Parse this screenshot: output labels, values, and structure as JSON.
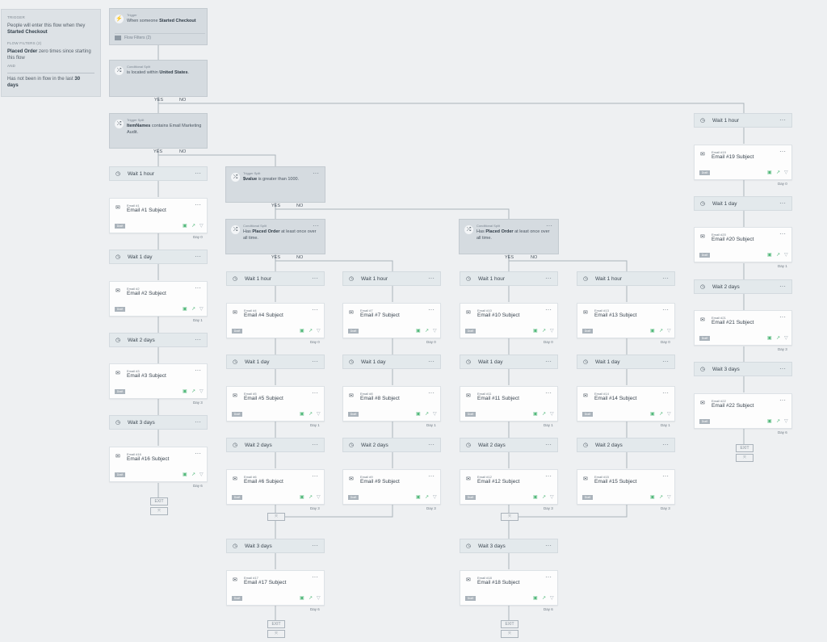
{
  "info": {
    "trigger_label": "Trigger",
    "trigger_line": "People will enter this flow when they",
    "trigger_event": "Started Checkout",
    "filters_label": "Flow Filters (2)",
    "filter1_event": "Placed Order",
    "filter1_rest": "zero times since starting this flow",
    "and_label": "And",
    "filter2_text": "Has not been in flow in the last",
    "filter2_num": "30",
    "filter2_unit": "days"
  },
  "trigger": {
    "label": "Trigger",
    "text": "When someone",
    "event": "Started Checkout",
    "filters_button": "Flow Filters (2)"
  },
  "split1": {
    "label": "Conditional Split",
    "pre": "is located",
    "mid": "within",
    "country": "United States",
    "post": "."
  },
  "split2": {
    "label": "Trigger Split",
    "field": "ItemNames",
    "text": "contains Email Marketing Audit."
  },
  "split3": {
    "label": "Trigger Split",
    "field": "$value",
    "text": "is greater than 1000."
  },
  "split4": {
    "label": "Conditional Split",
    "pre": "Has",
    "event": "Placed Order",
    "post": "at least once over all time."
  },
  "split5": {
    "label": "Conditional Split",
    "pre": "Has",
    "event": "Placed Order",
    "post": "at least once over all time."
  },
  "labels": {
    "yes": "YES",
    "no": "NO",
    "exit": "EXIT",
    "draft": "Draft",
    "menu": "···"
  },
  "waits": [
    {
      "label": "Wait 1 hour"
    },
    {
      "label": "Wait 1 day"
    },
    {
      "label": "Wait 2 days"
    },
    {
      "label": "Wait 3 days"
    },
    {
      "label": "Wait 1 hour"
    },
    {
      "label": "Wait 1 day"
    },
    {
      "label": "Wait 2 days"
    },
    {
      "label": "Wait 3 days"
    },
    {
      "label": "Wait 1 hour"
    },
    {
      "label": "Wait 1 day"
    },
    {
      "label": "Wait 2 days"
    },
    {
      "label": "Wait 1 hour"
    },
    {
      "label": "Wait 1 day"
    },
    {
      "label": "Wait 2 days"
    },
    {
      "label": "Wait 3 days"
    },
    {
      "label": "Wait 1 hour"
    },
    {
      "label": "Wait 1 day"
    },
    {
      "label": "Wait 2 days"
    },
    {
      "label": "Wait 1 hour"
    },
    {
      "label": "Wait 1 day"
    },
    {
      "label": "Wait 2 days"
    },
    {
      "label": "Wait 3 days"
    }
  ],
  "emails": [
    {
      "name": "Email #1",
      "subject": "Email #1 Subject",
      "day": "Day 0"
    },
    {
      "name": "Email #2",
      "subject": "Email #2 Subject",
      "day": "Day 1"
    },
    {
      "name": "Email #3",
      "subject": "Email #3 Subject",
      "day": "Day 3"
    },
    {
      "name": "Email #16",
      "subject": "Email #16 Subject",
      "day": "Day 6"
    },
    {
      "name": "Email #4",
      "subject": "Email #4 Subject",
      "day": "Day 0"
    },
    {
      "name": "Email #5",
      "subject": "Email #5 Subject",
      "day": "Day 1"
    },
    {
      "name": "Email #6",
      "subject": "Email #6 Subject",
      "day": "Day 3"
    },
    {
      "name": "Email #17",
      "subject": "Email #17 Subject",
      "day": "Day 6"
    },
    {
      "name": "Email #7",
      "subject": "Email #7 Subject",
      "day": "Day 0"
    },
    {
      "name": "Email #8",
      "subject": "Email #8 Subject",
      "day": "Day 1"
    },
    {
      "name": "Email #9",
      "subject": "Email #9 Subject",
      "day": "Day 3"
    },
    {
      "name": "Email #10",
      "subject": "Email #10 Subject",
      "day": "Day 0"
    },
    {
      "name": "Email #11",
      "subject": "Email #11 Subject",
      "day": "Day 1"
    },
    {
      "name": "Email #12",
      "subject": "Email #12 Subject",
      "day": "Day 3"
    },
    {
      "name": "Email #18",
      "subject": "Email #18 Subject",
      "day": "Day 6"
    },
    {
      "name": "Email #13",
      "subject": "Email #13 Subject",
      "day": "Day 0"
    },
    {
      "name": "Email #14",
      "subject": "Email #14 Subject",
      "day": "Day 1"
    },
    {
      "name": "Email #15",
      "subject": "Email #15 Subject",
      "day": "Day 3"
    },
    {
      "name": "Email #19",
      "subject": "Email #19 Subject",
      "day": "Day 0"
    },
    {
      "name": "Email #20",
      "subject": "Email #20 Subject",
      "day": "Day 1"
    },
    {
      "name": "Email #21",
      "subject": "Email #21 Subject",
      "day": "Day 3"
    },
    {
      "name": "Email #22",
      "subject": "Email #22 Subject",
      "day": "Day 6"
    }
  ],
  "colors": {
    "line": "#aab3bb",
    "active_icon": "#54b97c"
  }
}
